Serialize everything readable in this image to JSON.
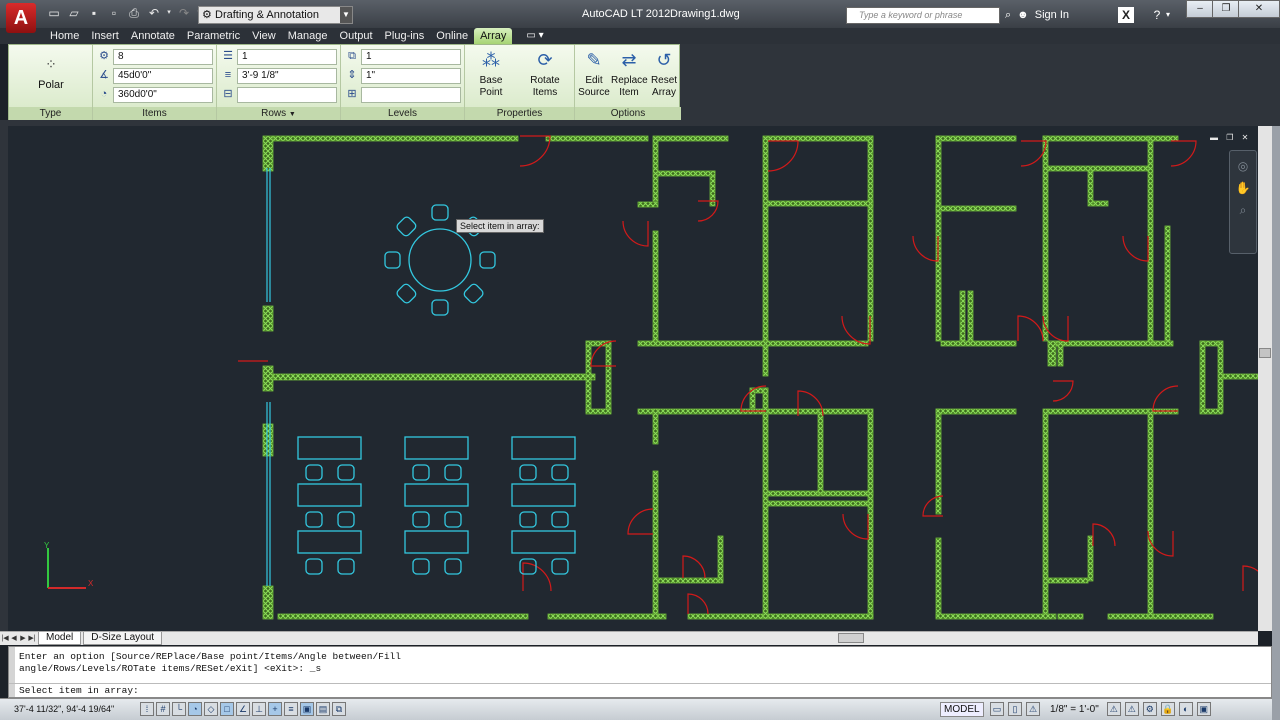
{
  "titlebar": {
    "logo_letter": "A",
    "workspace": "Drafting & Annotation",
    "app_title": "AutoCAD LT 2012",
    "doc_title": "Drawing1.dwg",
    "search_placeholder": "Type a keyword or phrase",
    "signin": "Sign In"
  },
  "ribbon_tabs": [
    "Home",
    "Insert",
    "Annotate",
    "Parametric",
    "View",
    "Manage",
    "Output",
    "Plug-ins",
    "Online",
    "Array"
  ],
  "active_tab": "Array",
  "ribbon": {
    "type_panel": {
      "title": "Type",
      "button": "Polar"
    },
    "items_panel": {
      "title": "Items",
      "count": "8",
      "angle_between": "45d0'0\"",
      "fill": "360d0'0\""
    },
    "rows_panel": {
      "title": "Rows",
      "rows": "1",
      "spacing": "3'-9 1/8\"",
      "total": ""
    },
    "levels_panel": {
      "title": "Levels",
      "levels": "1",
      "spacing": "1\"",
      "total": ""
    },
    "properties_panel": {
      "title": "Properties",
      "base_point": "Base Point",
      "rotate_items": "Rotate Items"
    },
    "options_panel": {
      "title": "Options",
      "edit_source": "Edit Source",
      "replace_item": "Replace Item",
      "reset_array": "Reset Array"
    }
  },
  "canvas": {
    "tooltip": "Select item in array:",
    "colors": {
      "background": "#212830",
      "wall": "#7ec840",
      "furniture": "#33c8e0",
      "door": "#d21a1a"
    }
  },
  "layout_tabs": [
    "Model",
    "D-Size Layout"
  ],
  "command_line": {
    "history_1": "Enter an option [Source/REPlace/Base point/Items/Angle between/Fill",
    "history_2": "angle/Rows/Levels/ROTate items/RESet/eXit] <eXit>: _s",
    "prompt": "Select item in array:"
  },
  "status_bar": {
    "coords": "37'-4 11/32\", 94'-4 19/64\"",
    "model": "MODEL",
    "scale": "1/8\" = 1'-0\""
  }
}
